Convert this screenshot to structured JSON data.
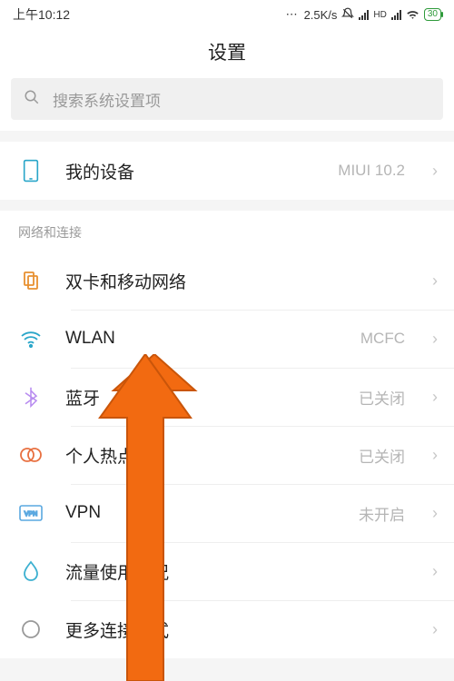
{
  "status": {
    "time": "上午10:12",
    "net_speed": "2.5K/s",
    "hd": "HD",
    "battery": "30"
  },
  "header": {
    "title": "设置"
  },
  "search": {
    "placeholder": "搜索系统设置项"
  },
  "device": {
    "label": "我的设备",
    "value": "MIUI 10.2"
  },
  "network_section": {
    "title": "网络和连接"
  },
  "rows": {
    "sim": {
      "label": "双卡和移动网络",
      "value": ""
    },
    "wlan": {
      "label": "WLAN",
      "value": "MCFC"
    },
    "bt": {
      "label": "蓝牙",
      "value": "已关闭"
    },
    "hotspot": {
      "label": "个人热点",
      "value": "已关闭"
    },
    "vpn": {
      "label": "VPN",
      "value": "未开启"
    },
    "traffic": {
      "label": "流量使用情况",
      "value": ""
    },
    "more": {
      "label": "更多连接方式",
      "value": ""
    }
  }
}
